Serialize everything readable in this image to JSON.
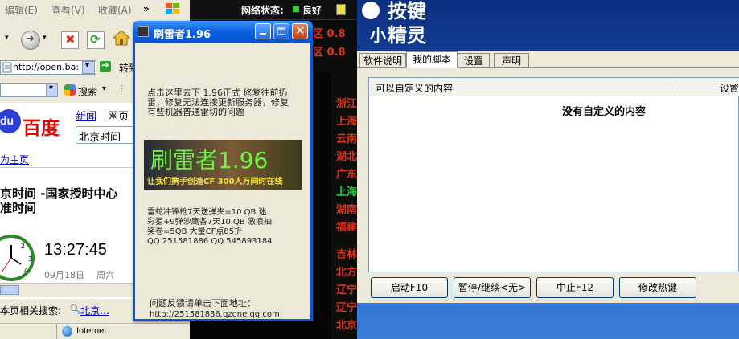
{
  "browser": {
    "menu": [
      "编辑(E)",
      "查看(V)",
      "收藏(A)",
      "»"
    ],
    "address": "http://open.ba:",
    "go_label": "转到",
    "search_label": "搜索",
    "search_dropdown": "▾",
    "baidu_logo": "百度",
    "baidu_du": "du",
    "baidu_nav": [
      "新闻",
      "网页"
    ],
    "baidu_query": "北京时间",
    "set_home": "为主页",
    "result_title_line1": "京时间  -国家授时中心",
    "result_title_line2": "准时间",
    "clock_time": "13:27:45",
    "clock_date": "09月18日",
    "clock_day": "周六",
    "related_label": "本页相关搜索:",
    "related_link": "北京…",
    "status_zone": "Internet"
  },
  "dark_app": {
    "status_label": "网络状态:",
    "status_value": "良好",
    "region_codes": [
      "区 0.8",
      "区 0.8"
    ],
    "regions": [
      "浙江",
      "上海",
      "云南",
      "湖北",
      "广东",
      "上海",
      "湖南",
      "福建",
      "吉林",
      "北方",
      "辽宁",
      "辽宁",
      "北京"
    ],
    "region_colors": [
      "#e23219",
      "#e23219",
      "#e23219",
      "#e23219",
      "#e23219",
      "#27d44a",
      "#e23219",
      "#e23219",
      "#e23219",
      "#e23219",
      "#e23219",
      "#e23219",
      "#e23219"
    ]
  },
  "popup": {
    "title": "刷雷者1.96",
    "notice": "点击这里去下  1.96正式  修复往前扔雷，修复无法连接更新服务器，修复有些机器普通雷切的问题",
    "banner_title": "刷雷者1.96",
    "banner_slogan": "让我们携手创造CF  300人万同时在线",
    "promo_lines": [
      "雷蛇冲锋枪7天送弹夹=10 QB   迷",
      "彩狙+9弹沙鹰各7天10 QB  激浪抽",
      "奖卷=5QB   大量CF点85折",
      "QQ 251581886   QQ 545893184"
    ],
    "feedback_label": "问题反馈请单击下面地址：",
    "feedback_url": "http://251581886.qzone.qq.com"
  },
  "right_app": {
    "logo_top": "按键",
    "logo_bottom": "精灵",
    "logo_small": "小",
    "tabs": [
      "软件说明",
      "我的脚本",
      "设置",
      "声明"
    ],
    "active_tab": "我的脚本",
    "col_content": "可以自定义的内容",
    "col_settings": "设置",
    "empty_message": "没有自定义的内容",
    "buttons": {
      "start": "启动F10",
      "pause": "暂停/继续<无>",
      "stop": "中止F12",
      "hotkey": "修改热键"
    }
  }
}
